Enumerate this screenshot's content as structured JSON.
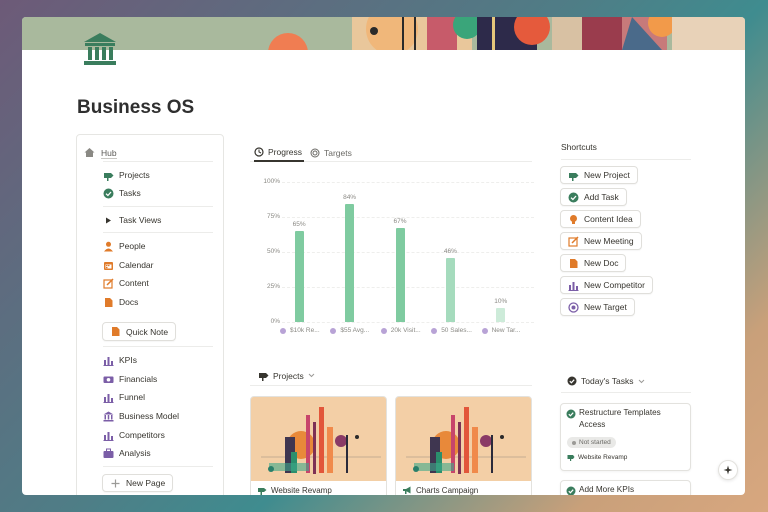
{
  "page": {
    "title": "Business OS",
    "icon": "bank-icon"
  },
  "sidebar": {
    "hub": "Hub",
    "group1": [
      "Projects",
      "Tasks"
    ],
    "task_views": "Task Views",
    "group2": [
      "People",
      "Calendar",
      "Content",
      "Docs"
    ],
    "quick_note": "Quick Note",
    "group3": [
      "KPIs",
      "Financials",
      "Funnel",
      "Business Model",
      "Competitors",
      "Analysis"
    ],
    "new_page": "New Page"
  },
  "tabs": [
    "Progress",
    "Targets"
  ],
  "chart_data": {
    "type": "bar",
    "categories": [
      "$10k Re...",
      "$55 Avg...",
      "20k Visit...",
      "50 Sales...",
      "New Tar..."
    ],
    "values": [
      65,
      84,
      67,
      46,
      10
    ],
    "data_labels": [
      "65%",
      "84%",
      "67%",
      "46%",
      "10%"
    ],
    "yticks": [
      "100%",
      "75%",
      "50%",
      "25%",
      "0%"
    ],
    "ylim": [
      0,
      100
    ],
    "colors": [
      "#7fcba0",
      "#7fcba0",
      "#7fcba0",
      "#a5dbbd",
      "#cdebd9"
    ],
    "legend_dot_color": "#b8a3d6",
    "grid": true
  },
  "projects": {
    "heading": "Projects",
    "cards": [
      "Website Revamp",
      "Charts Campaign"
    ]
  },
  "shortcuts": {
    "title": "Shortcuts",
    "buttons": [
      "New Project",
      "Add Task",
      "Content Idea",
      "New Meeting",
      "New Doc",
      "New Competitor",
      "New Target"
    ]
  },
  "todays_tasks": {
    "heading": "Today's Tasks",
    "tasks": [
      {
        "title": "Restructure Templates Access",
        "status": "Not started",
        "project": "Website Revamp"
      },
      {
        "title": "Add More KPIs"
      }
    ]
  },
  "colors": {
    "accent_green": "#3a7d5d",
    "orange": "#e07b2a",
    "purple": "#7b5ea7"
  }
}
